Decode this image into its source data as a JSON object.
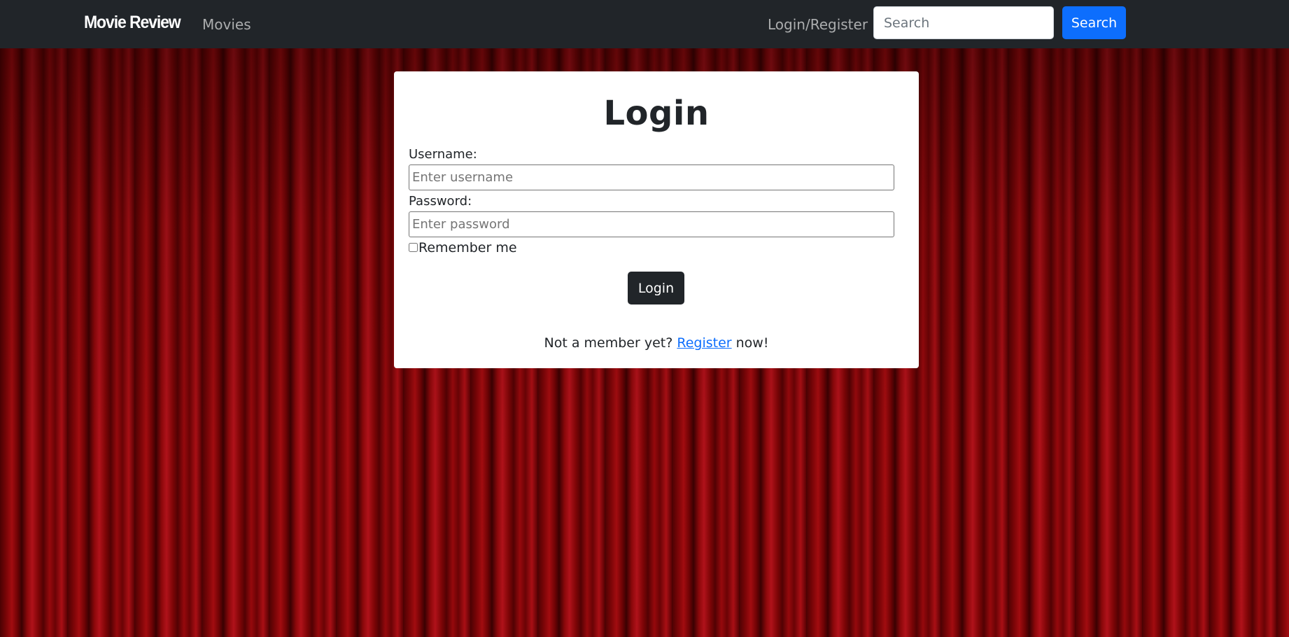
{
  "navbar": {
    "brand": "Movie Review",
    "links": {
      "movies": "Movies",
      "login_register": "Login/Register"
    },
    "search": {
      "placeholder": "Search",
      "value": "",
      "button_label": "Search"
    }
  },
  "login_form": {
    "title": "Login",
    "username": {
      "label": "Username:",
      "placeholder": "Enter username",
      "value": ""
    },
    "password": {
      "label": "Password:",
      "placeholder": "Enter password",
      "value": ""
    },
    "remember_me": {
      "label": "Remember me",
      "checked": false
    },
    "submit_label": "Login",
    "footer": {
      "prefix": "Not a member yet? ",
      "link_text": "Register",
      "suffix": " now!"
    }
  },
  "colors": {
    "navbar_bg": "#212529",
    "primary": "#0d6efd",
    "dark_button": "#212529",
    "background_curtain": "#8c080b"
  }
}
